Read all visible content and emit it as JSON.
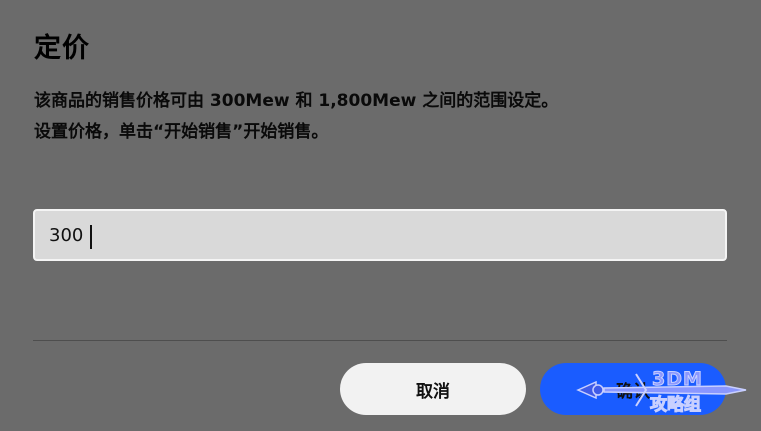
{
  "dialog": {
    "title": "定价",
    "description_line1": "该商品的销售价格可由 300Mew 和 1,800Mew 之间的范围设定。",
    "description_line2": "设置价格，单击“开始销售”开始销售。"
  },
  "price_input": {
    "value": "300",
    "placeholder": ""
  },
  "buttons": {
    "cancel_label": "取消",
    "confirm_label": "确认"
  },
  "watermark": {
    "line1": "3DM",
    "line2": "攻略组"
  },
  "colors": {
    "background": "#6b6b6b",
    "input_bg": "#d9d9d9",
    "cancel_bg": "#f2f2f2",
    "confirm_bg": "#1a5cff"
  }
}
